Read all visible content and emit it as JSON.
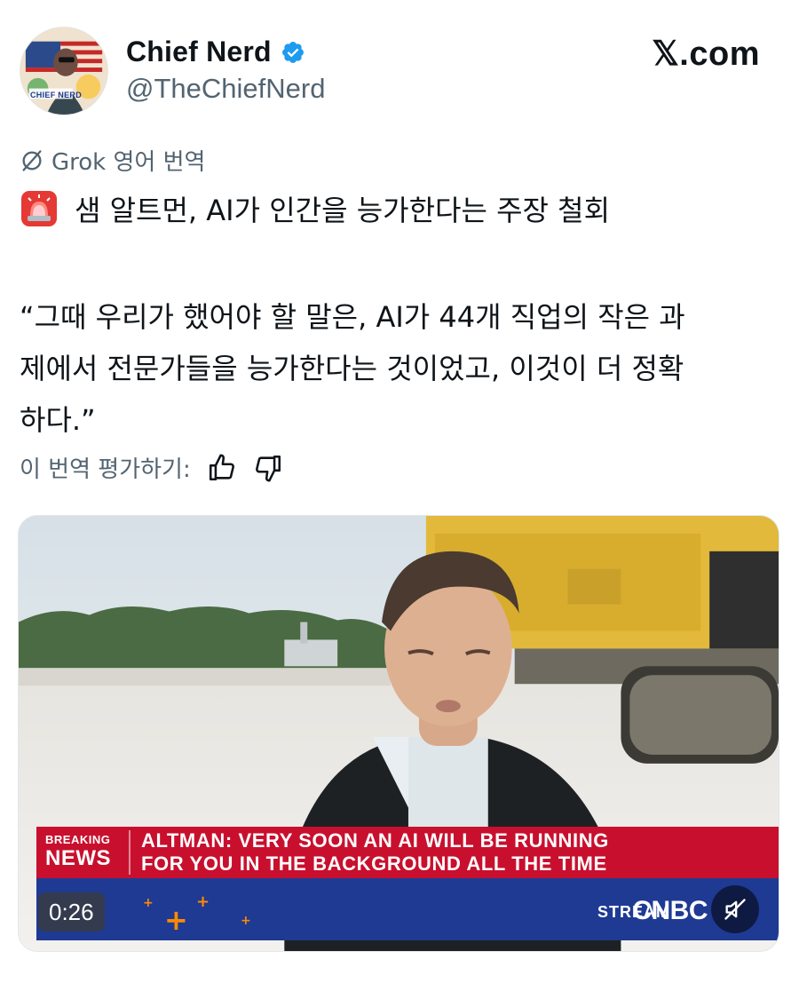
{
  "author": {
    "display_name": "Chief Nerd",
    "handle": "@TheChiefNerd",
    "avatar_text": "CHIEF NERD"
  },
  "brand": "𝕏.com",
  "translation": {
    "label": "Grok 영어 번역",
    "icon": "grok-icon"
  },
  "post": {
    "headline_icon": "siren-icon",
    "headline": "샘 알트먼, AI가 인간을 능가한다는 주장 철회",
    "quote_lines": [
      "“그때 우리가 했어야 할 말은, AI가 44개 직업의 작은 과",
      "제에서 전문가들을 능가한다는 것이었고, 이것이 더 정확",
      "하다.”"
    ]
  },
  "rating": {
    "label": "이 번역 평가하기:",
    "up_icon": "thumbs-up-icon",
    "down_icon": "thumbs-down-icon"
  },
  "video": {
    "breaking_line1": "BREAKING",
    "breaking_line2": "NEWS",
    "chyron_line1": "ALTMAN: VERY SOON AN AI WILL BE RUNNING",
    "chyron_line2": "FOR YOU IN THE BACKGROUND ALL THE TIME",
    "stream_label": "STREAM",
    "network": "CNBC",
    "timestamp": "0:26",
    "mute_icon": "mute-icon"
  },
  "colors": {
    "text_primary": "#0f1419",
    "text_secondary": "#536471",
    "verified_blue": "#1d9bf0",
    "chyron_red": "#c8102e",
    "chyron_blue": "#1f3a93",
    "accent_orange": "#ff8a00"
  }
}
